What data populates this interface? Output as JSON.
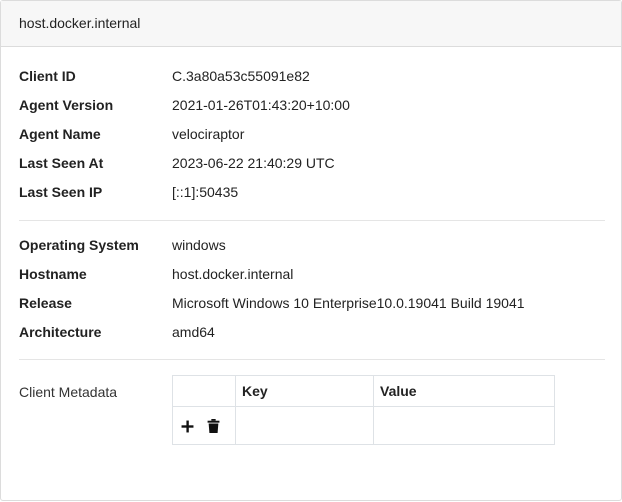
{
  "header": {
    "title": "host.docker.internal"
  },
  "client_info": [
    {
      "label": "Client ID",
      "value": "C.3a80a53c55091e82"
    },
    {
      "label": "Agent Version",
      "value": "2021-01-26T01:43:20+10:00"
    },
    {
      "label": "Agent Name",
      "value": "velociraptor"
    },
    {
      "label": "Last Seen At",
      "value": "2023-06-22 21:40:29 UTC"
    },
    {
      "label": "Last Seen IP",
      "value": "[::1]:50435"
    }
  ],
  "os_info": [
    {
      "label": "Operating System",
      "value": "windows"
    },
    {
      "label": "Hostname",
      "value": "host.docker.internal"
    },
    {
      "label": "Release",
      "value": "Microsoft Windows 10 Enterprise10.0.19041 Build 19041"
    },
    {
      "label": "Architecture",
      "value": "amd64"
    }
  ],
  "metadata": {
    "label": "Client Metadata",
    "columns": [
      "",
      "Key",
      "Value"
    ],
    "add_icon": "plus-icon",
    "delete_icon": "trash-icon"
  }
}
